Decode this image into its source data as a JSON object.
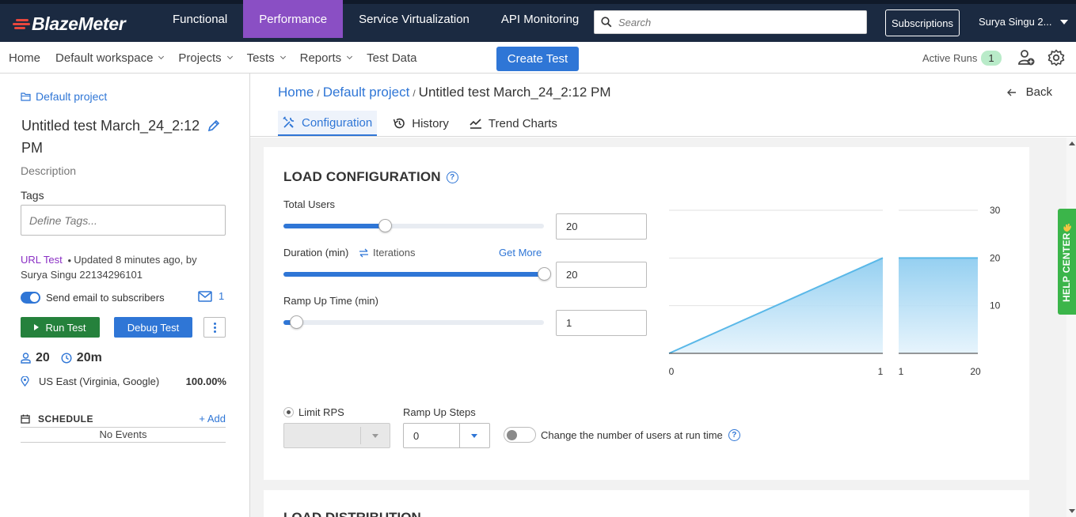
{
  "topnav": {
    "logo": "BlazeMeter",
    "items": [
      "Functional",
      "Performance",
      "Service Virtualization",
      "API Monitoring"
    ],
    "active": "Performance",
    "search_placeholder": "Search",
    "subscriptions": "Subscriptions",
    "user": "Surya Singu 2..."
  },
  "subnav": {
    "home": "Home",
    "workspace": "Default workspace",
    "projects": "Projects",
    "tests": "Tests",
    "reports": "Reports",
    "test_data": "Test Data",
    "create_test": "Create Test",
    "active_runs_label": "Active Runs",
    "active_runs_count": "1"
  },
  "left": {
    "project": "Default project",
    "title": "Untitled test March_24_2:12 PM",
    "description": "Description",
    "tags_label": "Tags",
    "tags_placeholder": "Define Tags...",
    "test_type": "URL Test",
    "updated": "Updated 8 minutes ago, by",
    "updated_by": "Surya Singu 22134296101",
    "email_label": "Send email to subscribers",
    "email_count": "1",
    "run_test": "Run Test",
    "debug_test": "Debug Test",
    "users": "20",
    "duration": "20m",
    "location": "US East (Virginia, Google)",
    "location_pct": "100.00%",
    "schedule_label": "SCHEDULE",
    "schedule_add": "+ Add",
    "no_events": "No Events"
  },
  "main": {
    "breadcrumb": [
      "Home",
      "Default project",
      "Untitled test March_24_2:12 PM"
    ],
    "back": "Back",
    "tabs": [
      "Configuration",
      "History",
      "Trend Charts"
    ],
    "active_tab": "Configuration"
  },
  "load": {
    "title": "LOAD CONFIGURATION",
    "total_users_label": "Total Users",
    "total_users": "20",
    "total_users_fraction": 0.39,
    "duration_label": "Duration (min)",
    "iterations_label": "Iterations",
    "get_more": "Get More",
    "duration": "20",
    "duration_fraction": 1.0,
    "rampup_label": "Ramp Up Time (min)",
    "rampup": "1",
    "rampup_fraction": 0.05,
    "limit_rps": "Limit RPS",
    "rampup_steps_label": "Ramp Up Steps",
    "rampup_steps": "0",
    "runtime_toggle_label": "Change the number of users at run time"
  },
  "chart_data": {
    "type": "area",
    "panels": [
      {
        "x": [
          0,
          1
        ],
        "y": [
          0,
          20
        ],
        "x_ticks": [
          "0",
          "1"
        ]
      },
      {
        "x": [
          1,
          20
        ],
        "y": [
          20,
          20
        ],
        "x_ticks": [
          "1",
          "20"
        ]
      }
    ],
    "y_ticks": [
      "30",
      "20",
      "10"
    ],
    "ylim": [
      0,
      30
    ],
    "grid": true,
    "color": "#5ab8e8"
  },
  "distribution": {
    "title": "LOAD DISTRIBUTION"
  },
  "help_center": "HELP CENTER"
}
